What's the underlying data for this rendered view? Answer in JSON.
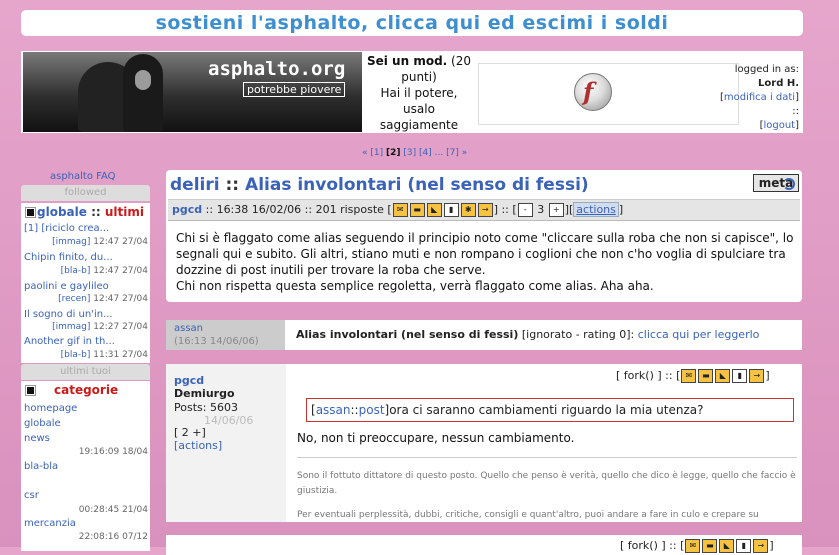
{
  "top_banner": "sostieni l'asphalto, clicca qui ed escimi i soldi",
  "logo": {
    "brand": "asphalto.org",
    "tagline": "potrebbe piovere"
  },
  "mod_box": {
    "line1_bold": "Sei un mod.",
    "line1_rest": "(20 punti)",
    "line2": "Hai il potere, usalo saggiamente"
  },
  "login": {
    "label": "logged in as:",
    "user": "Lord H.",
    "modify": "modifica i dati",
    "logout": "logout",
    "sep": "::"
  },
  "pager": {
    "prev": "«",
    "pages": [
      "[1]",
      "[2]",
      "[3]",
      "[4]",
      "...",
      "[7]"
    ],
    "current_index": 1,
    "next": "»"
  },
  "sidebar": {
    "faq": "asphalto FAQ",
    "followed_header": "followed",
    "globale_title_a": "globale",
    "globale_sep": "::",
    "globale_title_b": "ultimi",
    "globale_items": [
      {
        "title": "[1] [riciclo crea...",
        "tag": "[immag]",
        "time": "12:47 27/04"
      },
      {
        "title": "Chipin finito, du...",
        "tag": "[bla-b]",
        "time": "12:47 27/04"
      },
      {
        "title": "paolini e gaylileo",
        "tag": "[recen]",
        "time": "12:47 27/04"
      },
      {
        "title": "Il sogno di un'in...",
        "tag": "[immag]",
        "time": "12:27 27/04"
      },
      {
        "title": "Another gif in th...",
        "tag": "[bla-b]",
        "time": "11:31 27/04"
      }
    ],
    "ultimi_tuoi_header": "ultimi tuoi",
    "categorie_title": "categorie",
    "categories": [
      {
        "name": "homepage",
        "time": ""
      },
      {
        "name": "globale",
        "time": ""
      },
      {
        "name": "news",
        "time": "19:16:09 18/04"
      },
      {
        "name": "bla-bla",
        "time": ""
      },
      {
        "name": "csr",
        "time": "00:28:45 21/04"
      },
      {
        "name": "mercanzia",
        "time": "22:08:16 07/12"
      }
    ]
  },
  "post": {
    "section": "deliri",
    "sep": "::",
    "title": "Alias involontari (nel senso di fessi)",
    "meta_label": "meta",
    "author": "pgcd",
    "info": ":: 16:38 16/02/06 :: 201 risposte [",
    "info_after": "] :: [",
    "counter": "3",
    "actions": "actions",
    "body": "Chi si è flaggato come alias seguendo il principio noto come \"cliccare sulla roba che non si capisce\", lo segnali qui e subito. Gli altri, stiano muti e non rompano i coglioni che non c'ho voglia di spulciare tra dozzine di post inutili per trovare la roba che serve.\nChi non rispetta questa semplice regoletta, verrà flaggato come alias. Aha aha."
  },
  "comment_collapsed": {
    "author": "assan",
    "time": "(16:13 14/06/06)",
    "title": "Alias involontari (nel senso di fessi)",
    "status": "[ignorato - rating 0]:",
    "link": "clicca qui per leggerlo"
  },
  "comment2": {
    "author": "pgcd",
    "rank": "Demiurgo",
    "posts": "Posts: 5603",
    "time_faded": "14/06/06",
    "rating": "[ 2 +]",
    "actions": "[actions]",
    "fork": "[ fork() ] ::",
    "quote_user": "assan",
    "quote_sep": "::",
    "quote_link": "post",
    "quote_text": "ora ci saranno cambiamenti riguardo la mia utenza?",
    "answer": "No, non ti preoccupare, nessun cambiamento.",
    "signature": "Sono il fottuto dittatore di questo posto. Quello che penso è verità, quello che dico è legge, quello che faccio è giustizia.",
    "signature2": "Per eventuali perplessità, dubbi, critiche, consigli e quant'altro, puoi andare a fare in culo e crepare su"
  },
  "comment3": {
    "fork": "[ fork() ] ::"
  },
  "colors": {
    "accent": "#3d8fd0",
    "link": "#3a63b8",
    "background": "#e6a6cc",
    "categorie": "#cc1a1a"
  }
}
